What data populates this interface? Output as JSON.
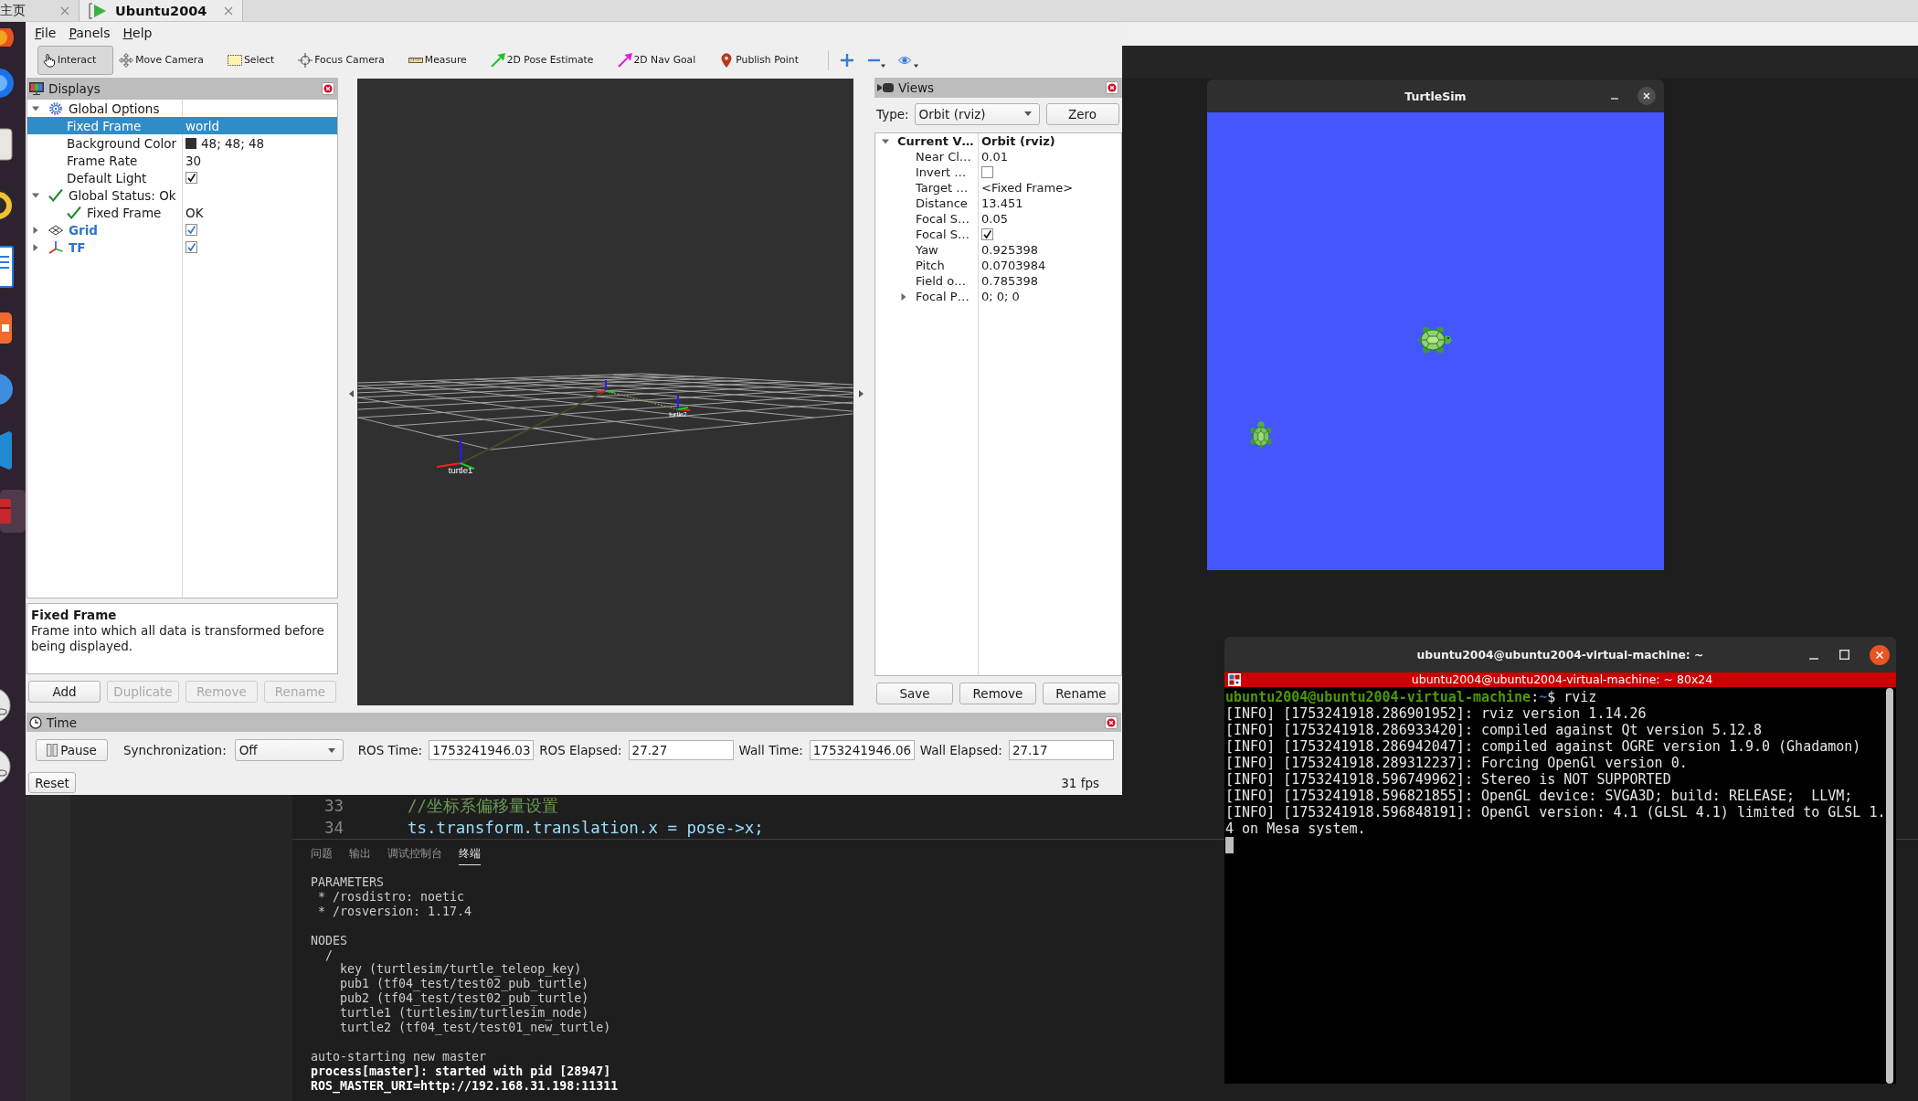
{
  "tab_bar": {
    "tabs": [
      {
        "label": "主页",
        "selected": false
      },
      {
        "label": "Ubuntu2004",
        "selected": true
      }
    ]
  },
  "rviz": {
    "menu": [
      "File",
      "Panels",
      "Help"
    ],
    "tools": [
      {
        "label": "Interact",
        "kind": "interact",
        "selected": true
      },
      {
        "label": "Move Camera",
        "kind": "move-camera",
        "selected": false
      },
      {
        "label": "Select",
        "kind": "select",
        "selected": false
      },
      {
        "label": "Focus Camera",
        "kind": "focus-camera",
        "selected": false
      },
      {
        "label": "Measure",
        "kind": "measure",
        "selected": false
      },
      {
        "label": "2D Pose Estimate",
        "kind": "pose-estimate",
        "selected": false
      },
      {
        "label": "2D Nav Goal",
        "kind": "nav-goal",
        "selected": false
      },
      {
        "label": "Publish Point",
        "kind": "publish-point",
        "selected": false
      }
    ],
    "displays": {
      "title": "Displays",
      "tree": [
        {
          "label": "Global Options",
          "kind": "options",
          "expanded": true,
          "selected": false,
          "children": [
            {
              "label": "Fixed Frame",
              "kind": "property",
              "value": "world",
              "selected": true
            },
            {
              "label": "Background Color",
              "kind": "property",
              "value": "48; 48; 48",
              "color": "#303030",
              "selected": false
            },
            {
              "label": "Frame Rate",
              "kind": "property",
              "value": "30",
              "selected": false
            },
            {
              "label": "Default Light",
              "kind": "property",
              "checked": true,
              "selected": false
            }
          ]
        },
        {
          "label": "Global Status: Ok",
          "kind": "status",
          "expanded": true,
          "selected": false,
          "children": [
            {
              "label": "Fixed Frame",
              "kind": "status",
              "value": "OK",
              "selected": false
            }
          ]
        },
        {
          "label": "Grid",
          "kind": "grid",
          "expanded": false,
          "checked": true,
          "selected": false
        },
        {
          "label": "TF",
          "kind": "tf",
          "expanded": false,
          "checked": true,
          "selected": false
        }
      ],
      "description": {
        "title": "Fixed Frame",
        "text": "Frame into which all data is transformed before being displayed."
      },
      "buttons": [
        {
          "label": "Add",
          "disabled": false
        },
        {
          "label": "Duplicate",
          "disabled": true
        },
        {
          "label": "Remove",
          "disabled": true
        },
        {
          "label": "Rename",
          "disabled": true
        }
      ]
    },
    "viewport": {
      "frame_labels": [
        "turtle1",
        "turtle2"
      ]
    },
    "views": {
      "title": "Views",
      "type_label": "Type:",
      "type_value": "Orbit (rviz)",
      "zero_button": "Zero",
      "tree": [
        {
          "label": "Current V…",
          "value": "Orbit (rviz)",
          "expanded": true,
          "selected": false,
          "children": [
            {
              "label": "Near Cl…",
              "value": "0.01",
              "selected": false
            },
            {
              "label": "Invert …",
              "checked": false,
              "selected": false
            },
            {
              "label": "Target …",
              "value": "<Fixed Frame>",
              "selected": false
            },
            {
              "label": "Distance",
              "value": "13.451",
              "selected": false
            },
            {
              "label": "Focal S…",
              "value": "0.05",
              "selected": false
            },
            {
              "label": "Focal S…",
              "checked": true,
              "selected": false
            },
            {
              "label": "Yaw",
              "value": "0.925398",
              "selected": false
            },
            {
              "label": "Pitch",
              "value": "0.0703984",
              "selected": false
            },
            {
              "label": "Field o…",
              "value": "0.785398",
              "selected": false
            },
            {
              "label": "Focal P…",
              "value": "0; 0; 0",
              "expanded": false,
              "selected": false
            }
          ]
        }
      ],
      "buttons": [
        "Save",
        "Remove",
        "Rename"
      ]
    },
    "time": {
      "title": "Time",
      "pause_button": "Pause",
      "sync_label": "Synchronization:",
      "sync_value": "Off",
      "fields": [
        {
          "label": "ROS Time:",
          "value": "1753241946.03"
        },
        {
          "label": "ROS Elapsed:",
          "value": "27.27"
        },
        {
          "label": "Wall Time:",
          "value": "1753241946.06"
        },
        {
          "label": "Wall Elapsed:",
          "value": "27.17"
        }
      ],
      "reset_button": "Reset",
      "fps": "31 fps"
    }
  },
  "editor": {
    "lines": [
      {
        "number": "33",
        "text": "//坐标系偏移量设置",
        "kind": "comment"
      },
      {
        "number": "34",
        "text": "ts.transform.translation.x = pose->x;",
        "kind": "code"
      }
    ],
    "panel_tabs": [
      {
        "label": "问题",
        "selected": false
      },
      {
        "label": "输出",
        "selected": false
      },
      {
        "label": "调试控制台",
        "selected": false
      },
      {
        "label": "终端",
        "selected": true
      }
    ],
    "output": [
      {
        "lines": [
          {
            "text": "PARAMETERS",
            "bold": false
          },
          {
            "text": " * /rosdistro: noetic",
            "bold": false
          },
          {
            "text": " * /rosversion: 1.17.4",
            "bold": false
          }
        ]
      },
      {
        "lines": [
          {
            "text": "NODES",
            "bold": false
          },
          {
            "text": "  /",
            "bold": false
          },
          {
            "text": "    key (turtlesim/turtle_teleop_key)",
            "bold": false
          },
          {
            "text": "    pub1 (tf04_test/test02_pub_turtle)",
            "bold": false
          },
          {
            "text": "    pub2 (tf04_test/test02_pub_turtle)",
            "bold": false
          },
          {
            "text": "    turtle1 (turtlesim/turtlesim_node)",
            "bold": false
          },
          {
            "text": "    turtle2 (tf04_test/test01_new_turtle)",
            "bold": false
          }
        ]
      },
      {
        "lines": [
          {
            "text": "auto-starting new master",
            "bold": false
          },
          {
            "text": "process[master]: started with pid [28947]",
            "bold": true
          },
          {
            "text": "ROS_MASTER_URI=http://192.168.31.198:11311",
            "bold": true
          }
        ]
      }
    ]
  },
  "turtlesim": {
    "title": "TurtleSim"
  },
  "terminal": {
    "title": "ubuntu2004@ubuntu2004-virtual-machine: ~",
    "tab_title": "ubuntu2004@ubuntu2004-virtual-machine: ~ 80x24",
    "prompt": [
      {
        "text": "ubuntu2004@ubuntu2004-virtual-machine",
        "kind": "user"
      },
      {
        "text": ":",
        "kind": "plain"
      },
      {
        "text": "~",
        "kind": "path"
      },
      {
        "text": "$ rviz",
        "kind": "plain"
      }
    ],
    "lines": [
      "[INFO] [1753241918.286901952]: rviz version 1.14.26",
      "[INFO] [1753241918.286933420]: compiled against Qt version 5.12.8",
      "[INFO] [1753241918.286942047]: compiled against OGRE version 1.9.0 (Ghadamon)",
      "[INFO] [1753241918.289312237]: Forcing OpenGl version 0.",
      "[INFO] [1753241918.596749962]: Stereo is NOT SUPPORTED",
      "[INFO] [1753241918.596821855]: OpenGL device: SVGA3D; build: RELEASE;  LLVM;",
      "[INFO] [1753241918.596848191]: OpenGl version: 4.1 (GLSL 4.1) limited to GLSL 1.4 on Mesa system."
    ]
  }
}
